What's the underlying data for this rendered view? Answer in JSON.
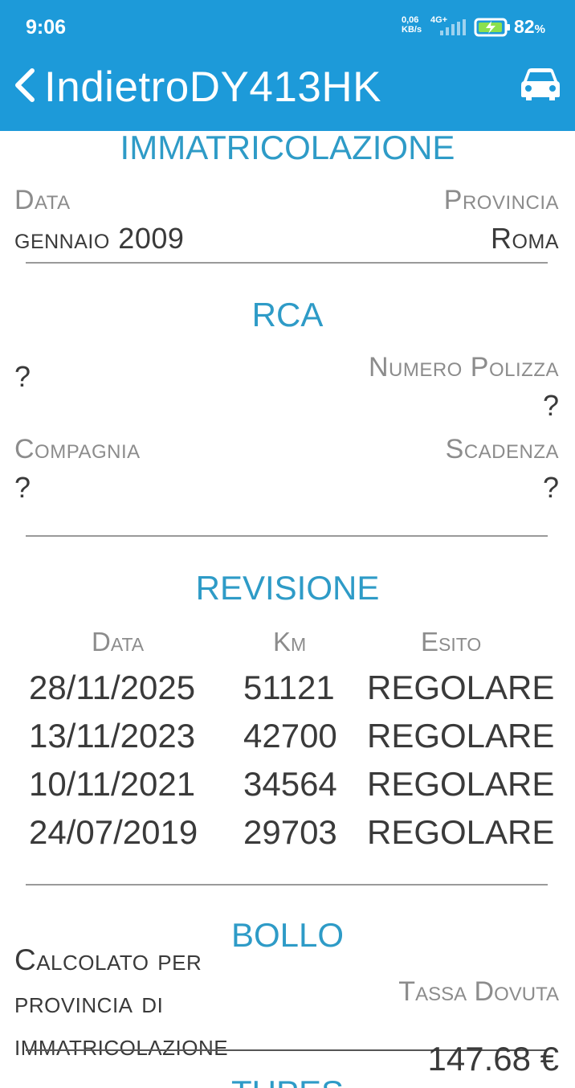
{
  "status_bar": {
    "time": "9:06",
    "net_speed": "0,06 KB/s",
    "network": "4G+",
    "battery": "82",
    "battery_unit": "%"
  },
  "nav": {
    "back_label": "Indietro",
    "plate": "DY413HK"
  },
  "immatricolazione": {
    "title": "IMMATRICOLAZIONE",
    "data_label": "Data",
    "data_value": "gennaio 2009",
    "provincia_label": "Provincia",
    "provincia_value": "Roma"
  },
  "rca": {
    "title": "RCA",
    "unknown_value": "?",
    "numero_polizza_label": "Numero Polizza",
    "numero_polizza_value": "?",
    "compagnia_label": "Compagnia",
    "compagnia_value": "?",
    "scadenza_label": "Scadenza",
    "scadenza_value": "?"
  },
  "revisione": {
    "title": "REVISIONE",
    "columns": [
      "Data",
      "Km",
      "Esito"
    ],
    "rows": [
      {
        "data": "28/11/2025",
        "km": "51121",
        "esito": "REGOLARE"
      },
      {
        "data": "13/11/2023",
        "km": "42700",
        "esito": "REGOLARE"
      },
      {
        "data": "10/11/2021",
        "km": "34564",
        "esito": "REGOLARE"
      },
      {
        "data": "24/07/2019",
        "km": "29703",
        "esito": "REGOLARE"
      }
    ]
  },
  "bollo": {
    "title": "BOLLO",
    "description": "Calcolato per provincia di immatricolazione",
    "tassa_label": "Tassa Dovuta",
    "tassa_value": "147.68 €"
  },
  "next_section": {
    "title": "TUPES"
  },
  "colors": {
    "header": "#1d9ad9",
    "section_title": "#2e9bc7",
    "label": "#8c8c8c",
    "text": "#3a3a3a"
  }
}
